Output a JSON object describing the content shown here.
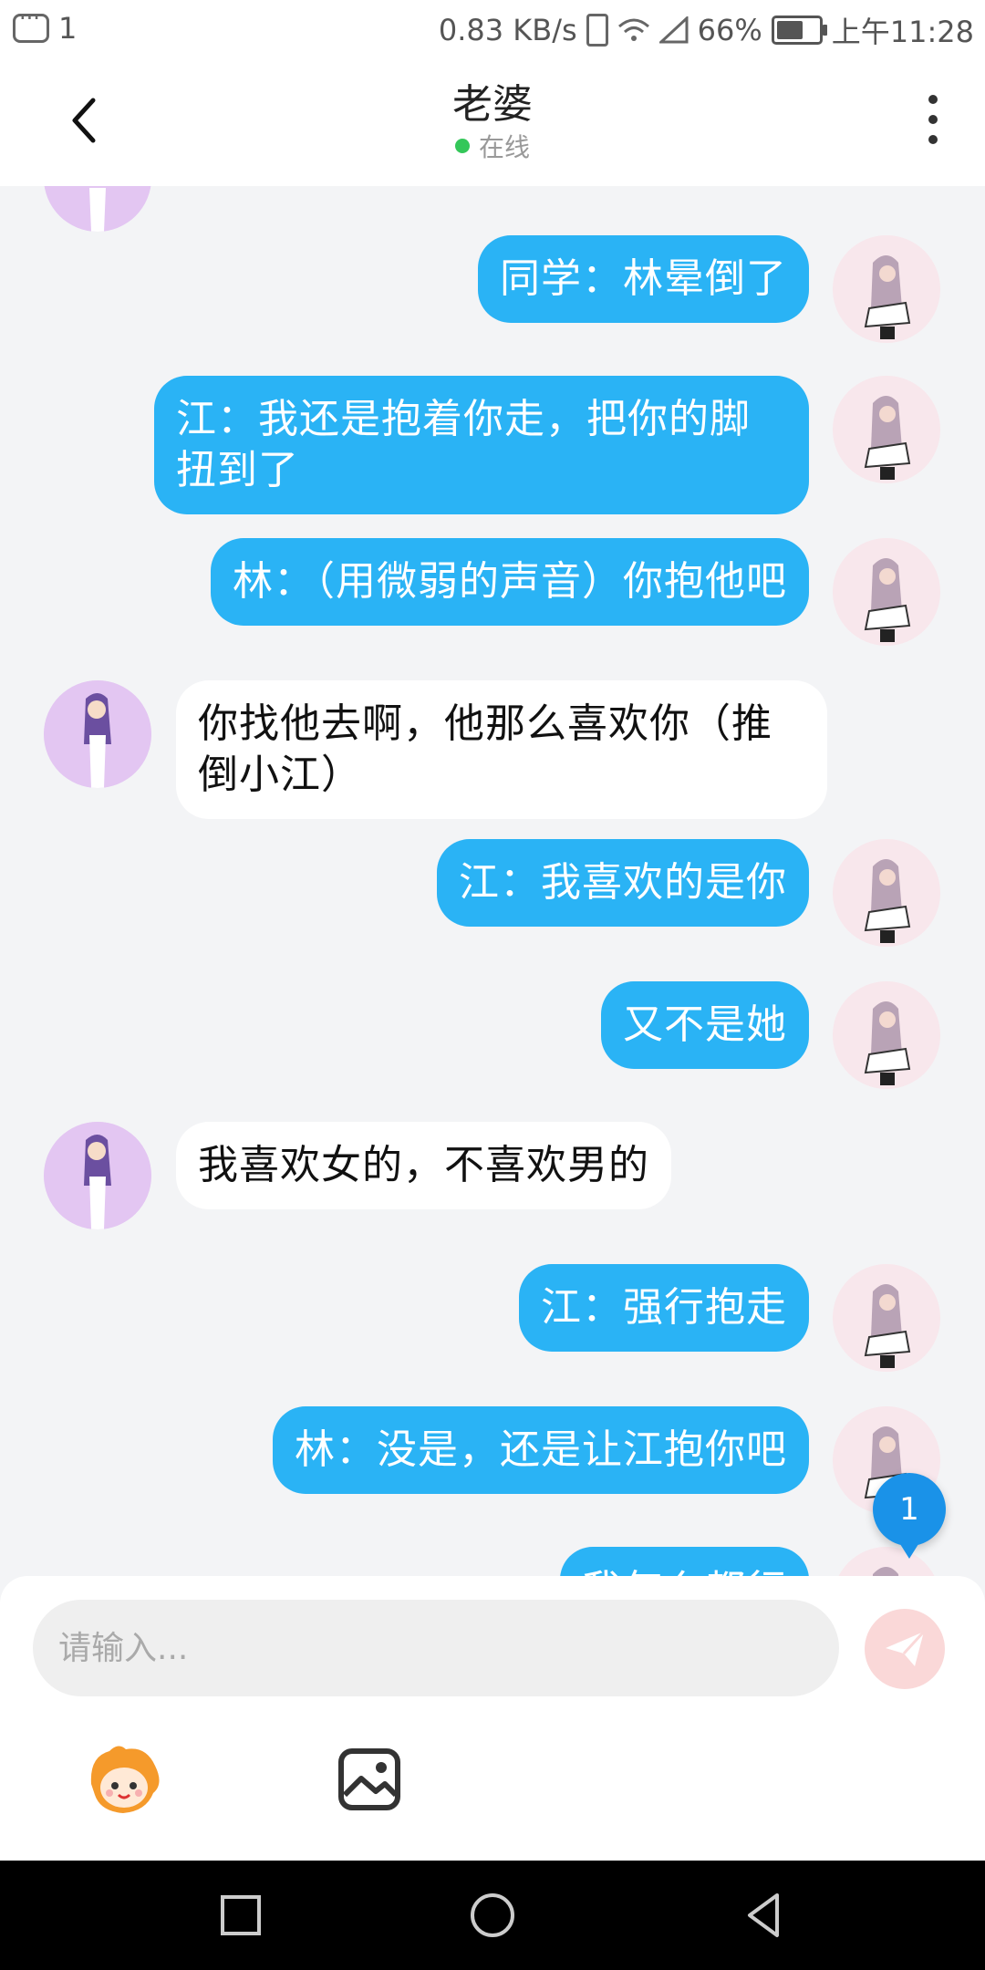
{
  "status_bar": {
    "notification_count": "1",
    "net_speed": "0.83 KB/s",
    "battery": "66%",
    "time": "上午11:28"
  },
  "header": {
    "title": "老婆",
    "status": "在线"
  },
  "messages": [
    {
      "side": "right",
      "text": "同学：林晕倒了"
    },
    {
      "side": "right",
      "text": "江：我还是抱着你走，把你的脚扭到了"
    },
    {
      "side": "right",
      "text": "林：（用微弱的声音）你抱他吧"
    },
    {
      "side": "left",
      "text": "你找他去啊，他那么喜欢你（推倒小江）"
    },
    {
      "side": "right",
      "text": "江：我喜欢的是你"
    },
    {
      "side": "right",
      "text": "又不是她"
    },
    {
      "side": "left",
      "text": "我喜欢女的，不喜欢男的"
    },
    {
      "side": "right",
      "text": "江：强行抱走"
    },
    {
      "side": "right",
      "text": "林：没是，还是让江抱你吧"
    },
    {
      "side": "right",
      "text": "我怎么都行"
    }
  ],
  "unread_badge": "1",
  "input": {
    "placeholder": "请输入..."
  },
  "icons": {
    "back": "back-arrow-icon",
    "more": "more-vertical-icon",
    "send": "send-icon",
    "emoji": "emoji-mascot-icon",
    "image": "image-icon"
  },
  "colors": {
    "bubble_self": "#2ab3f5",
    "bubble_other": "#ffffff",
    "online": "#34c759",
    "send_disabled": "#fad8d8",
    "badge": "#1a92e8"
  }
}
